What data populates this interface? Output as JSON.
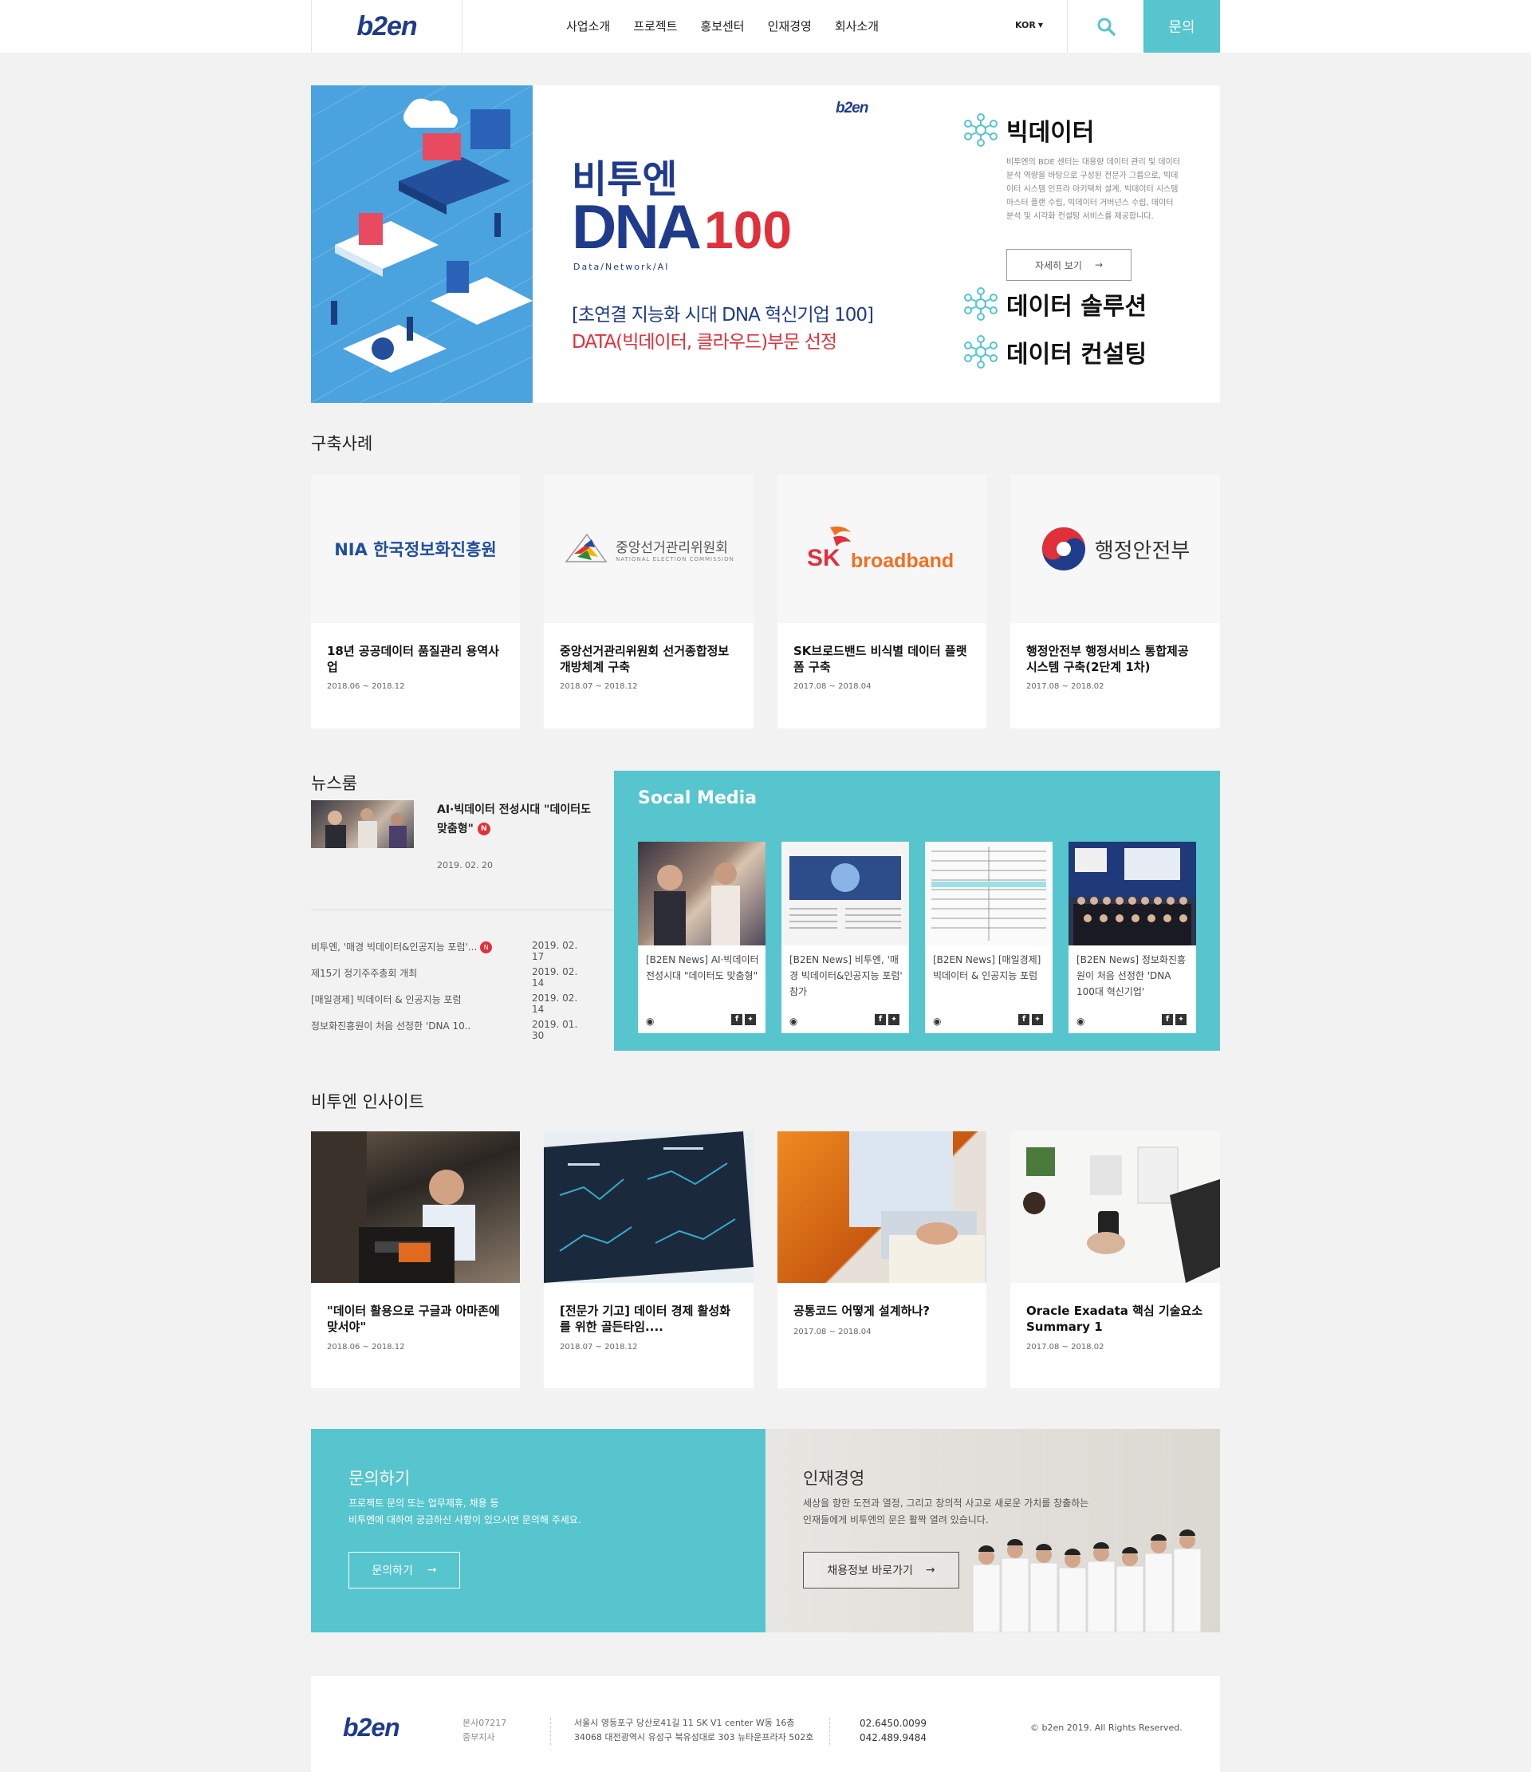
{
  "header": {
    "logo": "b2en",
    "nav": [
      "사업소개",
      "프로젝트",
      "홍보센터",
      "인재경영",
      "회사소개"
    ],
    "lang": "KOR",
    "inquiry": "문의"
  },
  "hero": {
    "banner_logo": "b2en",
    "banner_title_ko": "비투엔",
    "banner_title_en": "DNA",
    "banner_title_num": "100",
    "banner_subtitle": "Data/Network/AI",
    "banner_line1": "[초연결 지능화 시대 DNA 혁신기업 100]",
    "banner_line2": "DATA(빅데이터, 클라우드)부문 선정",
    "service1_title": "빅데이터",
    "service1_desc": "비투엔의 BDE 센터는 대용량 데이터 관리 및 데이터 분석 역량을 바탕으로 구성된 전문가 그룹으로, 빅데이터 시스템 인프라 아키텍처 설계, 빅데이터 시스템 마스터 플랜 수립, 빅데이터 거버넌스 수립, 데이터 분석 및 시각화 컨설팅 서비스를 제공합니다.",
    "service1_button": "자세히 보기",
    "service2_title": "데이터 솔루션",
    "service3_title": "데이터 컨설팅"
  },
  "cases": {
    "title": "구축사례",
    "items": [
      {
        "logo_text": "NIA 한국정보화진흥원",
        "title": "18년 공공데이터 품질관리 용역사업",
        "date": "2018.06 ~ 2018.12"
      },
      {
        "logo_text": "중앙선거관리위원회",
        "logo_sub": "NATIONAL ELECTION COMMISSION",
        "title": "중앙선거관리위원회 선거종합정보 개방체계 구축",
        "date": "2018.07 ~ 2018.12"
      },
      {
        "logo_text": "broadband",
        "logo_sk": "SK",
        "title": "SK브로드밴드 비식별 데이터 플랫폼 구축",
        "date": "2017.08 ~ 2018.04"
      },
      {
        "logo_text": "행정안전부",
        "title": "행정안전부 행정서비스 통합제공 시스템 구축(2단계 1차)",
        "date": "2017.08 ~ 2018.02"
      }
    ]
  },
  "newsroom": {
    "title": "뉴스룸",
    "featured_title": "AI·빅데이터 전성시대 \"데이터도 맞춤형\"",
    "featured_badge": "N",
    "featured_date": "2019. 02. 20",
    "list": [
      {
        "title": "비투엔, '매경 빅데이터&인공지능 포럼'...",
        "badge": "N",
        "date": "2019. 02. 17"
      },
      {
        "title": "제15기 정기주주총회 개최",
        "badge": "",
        "date": "2019. 02. 14"
      },
      {
        "title": "[매일경제] 빅데이터 & 인공지능 포럼",
        "badge": "",
        "date": "2019. 02. 14"
      },
      {
        "title": "정보화진흥원이 처음 선정한 'DNA 10..",
        "badge": "",
        "date": "2019. 01. 30"
      }
    ]
  },
  "social": {
    "title": "Socal Media",
    "items": [
      {
        "text": "[B2EN News] AI·빅데이터 전성시대 \"데이터도 맞춤형\""
      },
      {
        "text": "[B2EN News] 비투엔, '매경 빅데이터&인공지능 포럼' 참가"
      },
      {
        "text": "[B2EN News] [매일경제] 빅데이터 & 인공지능 포럼"
      },
      {
        "text": "[B2EN News] 정보화진흥원이 처음 선정한 'DNA 100대 혁신기업'"
      }
    ]
  },
  "insight": {
    "title": "비투엔 인사이트",
    "items": [
      {
        "title": "\"데이터 활용으로 구글과 아마존에 맞서야\"",
        "date": "2018.06 ~ 2018.12"
      },
      {
        "title": "[전문가 기고] 데이터 경제 활성화를 위한 골든타임....",
        "date": "2018.07 ~ 2018.12"
      },
      {
        "title": "공통코드 어떻게 설계하나?",
        "date": "2017.08 ~ 2018.04"
      },
      {
        "title": "Oracle Exadata 핵심 기술요소 Summary 1",
        "date": "2017.08 ~ 2018.02"
      }
    ]
  },
  "cta": {
    "contact_title": "문의하기",
    "contact_desc1": "프로젝트 문의 또는 업무제휴, 채용 등",
    "contact_desc2": "비투엔에 대하여 궁금하신 사항이 있으시면 문의해 주세요.",
    "contact_button": "문의하기",
    "hr_title": "인재경영",
    "hr_desc1": "세상을 향한 도전과 열정, 그리고 창의적 사고로 새로운 가치를 창출하는",
    "hr_desc2": "인재들에게 비투엔의 문은 활짝 열려 있습니다.",
    "hr_button": "채용정보 바로가기"
  },
  "footer": {
    "logo": "b2en",
    "label1": "본사07217",
    "label2": "중부지사",
    "addr1": "서울시 영등포구 당산로41길 11 SK V1 center W동 16층",
    "addr2": "34068 대전광역시 유성구 북유성대로 303 뉴타운프라자 502호",
    "phone1": "02.6450.0099",
    "phone2": "042.489.9484",
    "copyright": "© b2en 2019. All Rights Reserved."
  },
  "colors": {
    "accent": "#56c5cd",
    "brand": "#1f3b8c",
    "red": "#e0303a"
  }
}
